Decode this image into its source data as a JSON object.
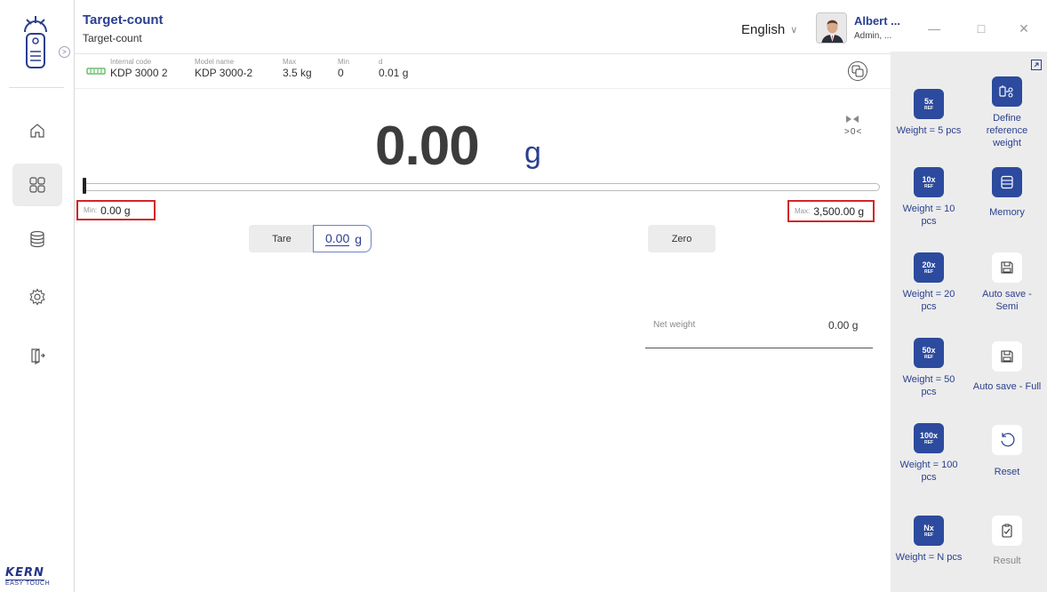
{
  "app": {
    "title": "Target-count",
    "subtitle": "Target-count",
    "language": "English",
    "user": {
      "name": "Albert ...",
      "role": "Admin, ..."
    }
  },
  "brand": {
    "line1": "KERN",
    "line2": "EASY TOUCH"
  },
  "nav": [
    "home",
    "applications",
    "database",
    "settings",
    "logout"
  ],
  "specs": {
    "internal_code": {
      "label": "Internal code",
      "value": "KDP 3000 2"
    },
    "model_name": {
      "label": "Model name",
      "value": "KDP 3000-2"
    },
    "max": {
      "label": "Max",
      "value": "3.5 kg"
    },
    "min": {
      "label": "Min",
      "value": "0"
    },
    "d": {
      "label": "d",
      "value": "0.01 g"
    }
  },
  "display": {
    "weight": "0.00",
    "unit": "g",
    "zero_indicator": ">0<",
    "min_label": "Min:",
    "min_value": "0.00 g",
    "max_label": "Max:",
    "max_value": "3,500.00 g",
    "bargraph_fraction": 0.0
  },
  "controls": {
    "tare_label": "Tare",
    "tare_value": "0.00",
    "tare_unit": "g",
    "zero_label": "Zero"
  },
  "result": {
    "net_label": "Net weight",
    "net_value": "0.00 g"
  },
  "functions": {
    "ref5": {
      "mult": "5x",
      "ref": "REF",
      "label": "Weight = 5 pcs"
    },
    "ref10": {
      "mult": "10x",
      "ref": "REF",
      "label": "Weight = 10 pcs"
    },
    "ref20": {
      "mult": "20x",
      "ref": "REF",
      "label": "Weight = 20 pcs"
    },
    "ref50": {
      "mult": "50x",
      "ref": "REF",
      "label": "Weight = 50 pcs"
    },
    "ref100": {
      "mult": "100x",
      "ref": "REF",
      "label": "Weight = 100 pcs"
    },
    "refN": {
      "mult": "Nx",
      "ref": "REF",
      "label": "Weight = N pcs"
    },
    "define_ref": {
      "label": "Define reference weight"
    },
    "memory": {
      "label": "Memory"
    },
    "autosave_semi": {
      "label": "Auto save - Semi"
    },
    "autosave_full": {
      "label": "Auto save - Full"
    },
    "reset": {
      "label": "Reset"
    },
    "result": {
      "label": "Result"
    }
  },
  "colors": {
    "accent": "#2a3f8e",
    "button_blue": "#2c4a9e",
    "highlight_red": "#d32626",
    "panel_bg": "#ececec"
  }
}
